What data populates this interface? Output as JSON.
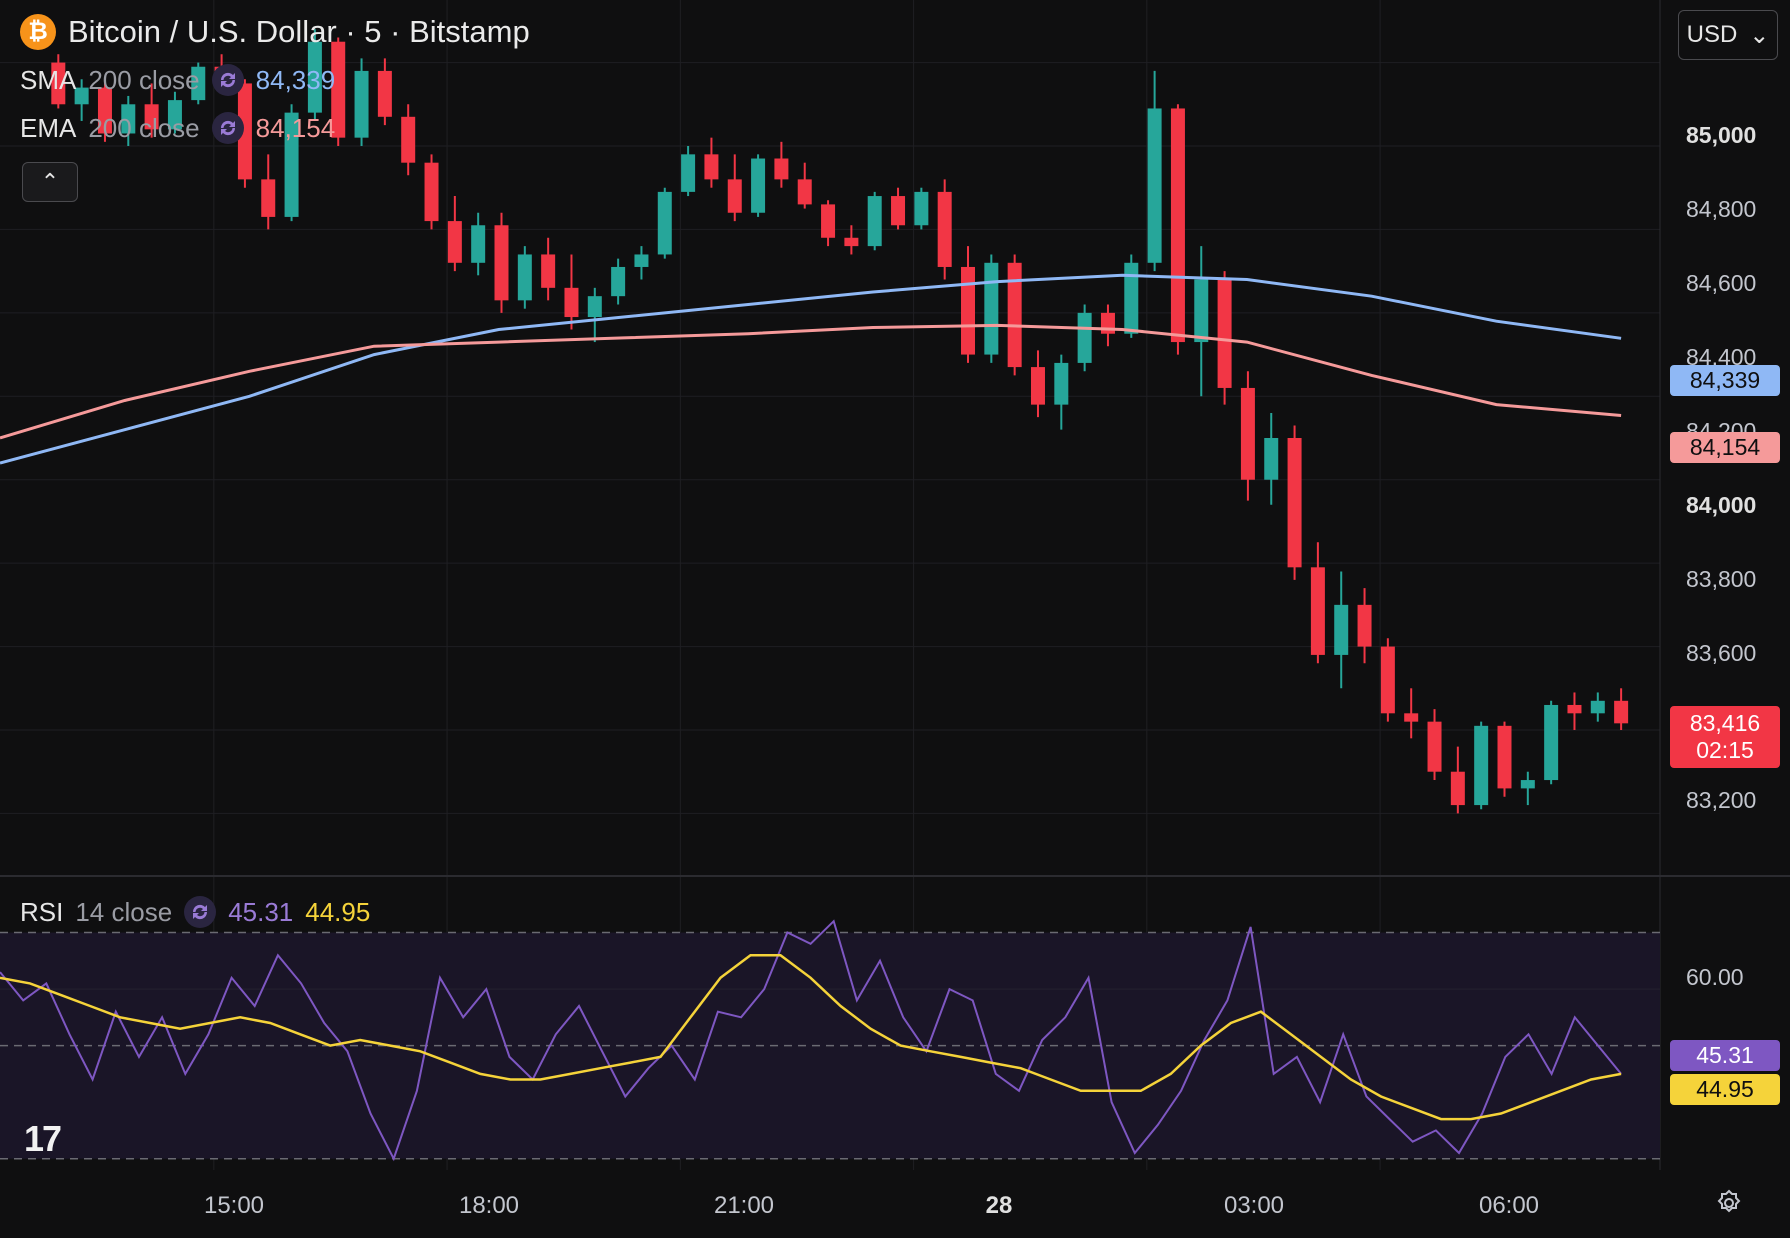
{
  "header": {
    "coin_icon": "bitcoin-icon",
    "title": "Bitcoin / U.S. Dollar · 5 · Bitstamp",
    "currency": "USD"
  },
  "indicators": {
    "sma": {
      "name": "SMA",
      "params": "200 close",
      "value": "84,339",
      "color": "#8fb8f5"
    },
    "ema": {
      "name": "EMA",
      "params": "200 close",
      "value": "84,154",
      "color": "#f59a9a"
    },
    "rsi": {
      "name": "RSI",
      "params": "14 close",
      "value": "45.31",
      "ma_value": "44.95",
      "color": "#7e57c2",
      "ma_color": "#f5d33a"
    }
  },
  "price_axis": {
    "labels": [
      "85,000",
      "84,800",
      "84,600",
      "84,400",
      "84,200",
      "84,000",
      "83,800",
      "83,600",
      "83,200"
    ],
    "last_price": "83,416",
    "countdown": "02:15",
    "sma_tag": "84,339",
    "ema_tag": "84,154"
  },
  "rsi_axis": {
    "labels": [
      "60.00"
    ],
    "rsi_tag": "45.31",
    "ma_tag": "44.95"
  },
  "time_axis": {
    "labels": [
      "15:00",
      "18:00",
      "21:00",
      "28",
      "03:00",
      "06:00"
    ]
  },
  "colors": {
    "up": "#26a69a",
    "down": "#f23645",
    "background": "#0f0f10",
    "rsi_band": "#1a1527"
  },
  "chart_data": {
    "type": "candlestick",
    "title": "Bitcoin / U.S. Dollar · 5 · Bitstamp",
    "interval_minutes": 5,
    "ylim": [
      83050,
      85150
    ],
    "grid": true,
    "series": [
      {
        "name": "SMA 200 close",
        "points": [
          [
            0,
            84040
          ],
          [
            4,
            84120
          ],
          [
            8,
            84200
          ],
          [
            12,
            84300
          ],
          [
            16,
            84360
          ],
          [
            20,
            84390
          ],
          [
            24,
            84420
          ],
          [
            28,
            84450
          ],
          [
            32,
            84475
          ],
          [
            36,
            84490
          ],
          [
            40,
            84480
          ],
          [
            44,
            84440
          ],
          [
            48,
            84380
          ],
          [
            52,
            84339
          ]
        ]
      },
      {
        "name": "EMA 200 close",
        "points": [
          [
            0,
            84100
          ],
          [
            4,
            84190
          ],
          [
            8,
            84260
          ],
          [
            12,
            84320
          ],
          [
            16,
            84330
          ],
          [
            20,
            84340
          ],
          [
            24,
            84350
          ],
          [
            28,
            84365
          ],
          [
            32,
            84370
          ],
          [
            36,
            84360
          ],
          [
            40,
            84330
          ],
          [
            44,
            84250
          ],
          [
            48,
            84180
          ],
          [
            52,
            84154
          ]
        ]
      }
    ],
    "candles": [
      [
        13.0,
        85000,
        85020,
        84890,
        84900
      ],
      [
        13.3,
        84900,
        84960,
        84860,
        84940
      ],
      [
        13.6,
        84940,
        84960,
        84810,
        84830
      ],
      [
        13.9,
        84830,
        84920,
        84800,
        84900
      ],
      [
        14.2,
        84900,
        84950,
        84820,
        84840
      ],
      [
        14.5,
        84840,
        84930,
        84830,
        84910
      ],
      [
        14.8,
        84910,
        85000,
        84900,
        84990
      ],
      [
        15.1,
        84990,
        85020,
        84930,
        84950
      ],
      [
        15.4,
        84950,
        84960,
        84700,
        84720
      ],
      [
        15.7,
        84720,
        84780,
        84600,
        84630
      ],
      [
        16.0,
        84630,
        84900,
        84620,
        84880
      ],
      [
        16.3,
        84880,
        85080,
        84860,
        85050
      ],
      [
        16.6,
        85050,
        85060,
        84800,
        84820
      ],
      [
        16.9,
        84820,
        85010,
        84800,
        84980
      ],
      [
        17.2,
        84980,
        85010,
        84850,
        84870
      ],
      [
        17.5,
        84870,
        84900,
        84730,
        84760
      ],
      [
        17.8,
        84760,
        84780,
        84600,
        84620
      ],
      [
        18.1,
        84620,
        84680,
        84500,
        84520
      ],
      [
        18.4,
        84520,
        84640,
        84490,
        84610
      ],
      [
        18.7,
        84610,
        84640,
        84400,
        84430
      ],
      [
        19.0,
        84430,
        84560,
        84410,
        84540
      ],
      [
        19.3,
        84540,
        84580,
        84430,
        84460
      ],
      [
        19.6,
        84460,
        84540,
        84360,
        84390
      ],
      [
        19.9,
        84390,
        84460,
        84330,
        84440
      ],
      [
        20.2,
        84440,
        84530,
        84420,
        84510
      ],
      [
        20.5,
        84510,
        84560,
        84480,
        84540
      ],
      [
        20.8,
        84540,
        84700,
        84530,
        84690
      ],
      [
        21.1,
        84690,
        84800,
        84680,
        84780
      ],
      [
        21.4,
        84780,
        84820,
        84700,
        84720
      ],
      [
        21.7,
        84720,
        84780,
        84620,
        84640
      ],
      [
        22.0,
        84640,
        84780,
        84630,
        84770
      ],
      [
        22.3,
        84770,
        84810,
        84700,
        84720
      ],
      [
        22.6,
        84720,
        84760,
        84650,
        84660
      ],
      [
        22.9,
        84660,
        84670,
        84560,
        84580
      ],
      [
        23.2,
        84580,
        84610,
        84540,
        84560
      ],
      [
        23.5,
        84560,
        84690,
        84550,
        84680
      ],
      [
        23.8,
        84680,
        84700,
        84600,
        84610
      ],
      [
        24.1,
        84610,
        84700,
        84600,
        84690
      ],
      [
        24.4,
        84690,
        84720,
        84480,
        84510
      ],
      [
        24.7,
        84510,
        84560,
        84280,
        84300
      ],
      [
        25.0,
        84300,
        84540,
        84280,
        84520
      ],
      [
        25.3,
        84520,
        84540,
        84250,
        84270
      ],
      [
        25.6,
        84270,
        84310,
        84150,
        84180
      ],
      [
        25.9,
        84180,
        84300,
        84120,
        84280
      ],
      [
        26.2,
        84280,
        84420,
        84260,
        84400
      ],
      [
        26.5,
        84400,
        84420,
        84320,
        84350
      ],
      [
        26.8,
        84350,
        84540,
        84340,
        84520
      ],
      [
        27.1,
        84520,
        84980,
        84500,
        84890
      ],
      [
        27.4,
        84890,
        84900,
        84300,
        84330
      ],
      [
        27.7,
        84330,
        84560,
        84200,
        84480
      ],
      [
        28.0,
        84480,
        84500,
        84180,
        84220
      ],
      [
        28.3,
        84220,
        84260,
        83950,
        84000
      ],
      [
        28.6,
        84000,
        84160,
        83940,
        84100
      ],
      [
        28.9,
        84100,
        84130,
        83760,
        83790
      ],
      [
        29.2,
        83790,
        83850,
        83560,
        83580
      ],
      [
        29.5,
        83580,
        83780,
        83500,
        83700
      ],
      [
        29.8,
        83700,
        83740,
        83560,
        83600
      ],
      [
        30.1,
        83600,
        83620,
        83420,
        83440
      ],
      [
        30.4,
        83440,
        83500,
        83380,
        83420
      ],
      [
        30.7,
        83420,
        83450,
        83280,
        83300
      ],
      [
        31.0,
        83300,
        83360,
        83200,
        83220
      ],
      [
        31.3,
        83220,
        83420,
        83210,
        83410
      ],
      [
        31.6,
        83410,
        83420,
        83240,
        83260
      ],
      [
        31.9,
        83260,
        83300,
        83220,
        83280
      ],
      [
        32.2,
        83280,
        83470,
        83270,
        83460
      ],
      [
        32.5,
        83460,
        83490,
        83400,
        83440
      ],
      [
        32.8,
        83440,
        83490,
        83420,
        83470
      ],
      [
        33.1,
        83470,
        83500,
        83400,
        83416
      ]
    ],
    "rsi": {
      "name": "RSI 14 close",
      "ylim": [
        28,
        80
      ],
      "levels": [
        70,
        50,
        30
      ],
      "series": [
        {
          "name": "RSI",
          "values": [
            63,
            58,
            61,
            52,
            44,
            56,
            48,
            55,
            45,
            52,
            62,
            57,
            66,
            61,
            54,
            49,
            38,
            30,
            42,
            62,
            55,
            60,
            48,
            44,
            52,
            57,
            49,
            41,
            46,
            50,
            44,
            56,
            55,
            60,
            70,
            68,
            72,
            58,
            65,
            55,
            49,
            60,
            58,
            45,
            42,
            51,
            55,
            62,
            40,
            31,
            36,
            42,
            51,
            58,
            71,
            45,
            48,
            40,
            52,
            41,
            37,
            33,
            35,
            31,
            38,
            48,
            52,
            45,
            55,
            50,
            45
          ]
        },
        {
          "name": "RSI MA",
          "values": [
            62,
            61,
            59,
            57,
            55,
            54,
            53,
            54,
            55,
            54,
            52,
            50,
            51,
            50,
            49,
            47,
            45,
            44,
            44,
            45,
            46,
            47,
            48,
            55,
            62,
            66,
            66,
            62,
            57,
            53,
            50,
            49,
            48,
            47,
            46,
            44,
            42,
            42,
            42,
            45,
            50,
            54,
            56,
            52,
            48,
            44,
            41,
            39,
            37,
            37,
            38,
            40,
            42,
            44,
            45
          ]
        }
      ]
    }
  }
}
